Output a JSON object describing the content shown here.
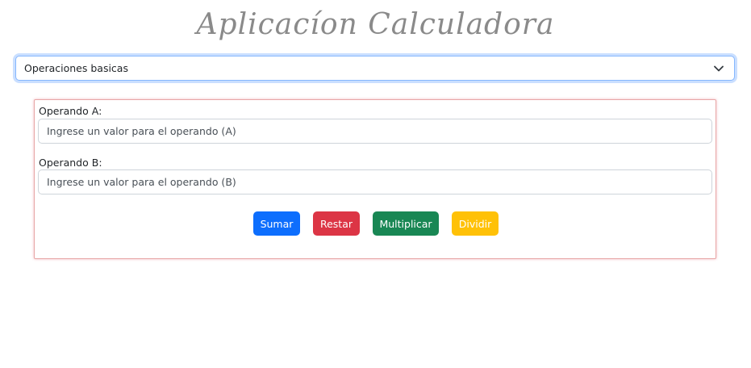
{
  "app": {
    "title": "Aplicacíon Calculadora"
  },
  "operation_select": {
    "selected": "Operaciones basicas",
    "icon": "chevron-down-icon"
  },
  "form": {
    "operand_a": {
      "label": "Operando A:",
      "placeholder": "Ingrese un valor para el operando (A)",
      "value": ""
    },
    "operand_b": {
      "label": "Operando B:",
      "placeholder": "Ingrese un valor para el operando (B)",
      "value": ""
    },
    "buttons": {
      "sumar": {
        "label": "Sumar",
        "color": "#0d6efd"
      },
      "restar": {
        "label": "Restar",
        "color": "#dc3545"
      },
      "multiplicar": {
        "label": "Multiplicar",
        "color": "#198754"
      },
      "dividir": {
        "label": "Dividir",
        "color": "#ffc107"
      }
    }
  },
  "colors": {
    "title": "#8a8a8a",
    "card_border": "#e8a7a7",
    "select_focus": "#86b7fe"
  }
}
